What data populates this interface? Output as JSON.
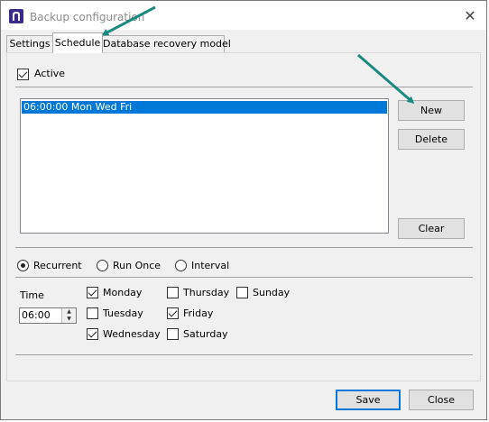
{
  "window": {
    "title": "Backup configuration"
  },
  "tabs": [
    {
      "label": "Settings"
    },
    {
      "label": "Schedule"
    },
    {
      "label": "Database recovery model"
    }
  ],
  "schedule": {
    "active_label": "Active",
    "active_checked": true,
    "list_items": [
      "06:00:00 Mon Wed Fri"
    ],
    "buttons": {
      "new": "New",
      "delete": "Delete",
      "clear": "Clear"
    },
    "modes": [
      {
        "label": "Recurrent",
        "selected": true
      },
      {
        "label": "Run Once",
        "selected": false
      },
      {
        "label": "Interval",
        "selected": false
      }
    ],
    "time_label": "Time",
    "time_value": "06:00",
    "days": [
      {
        "label": "Monday",
        "checked": true
      },
      {
        "label": "Tuesday",
        "checked": false
      },
      {
        "label": "Wednesday",
        "checked": true
      },
      {
        "label": "Thursday",
        "checked": false
      },
      {
        "label": "Friday",
        "checked": true
      },
      {
        "label": "Saturday",
        "checked": false
      },
      {
        "label": "Sunday",
        "checked": false
      }
    ]
  },
  "footer": {
    "save": "Save",
    "close": "Close"
  },
  "colors": {
    "selection": "#0078d7",
    "annotation_arrow": "#1a8a80",
    "icon": "#3b2a8c"
  }
}
